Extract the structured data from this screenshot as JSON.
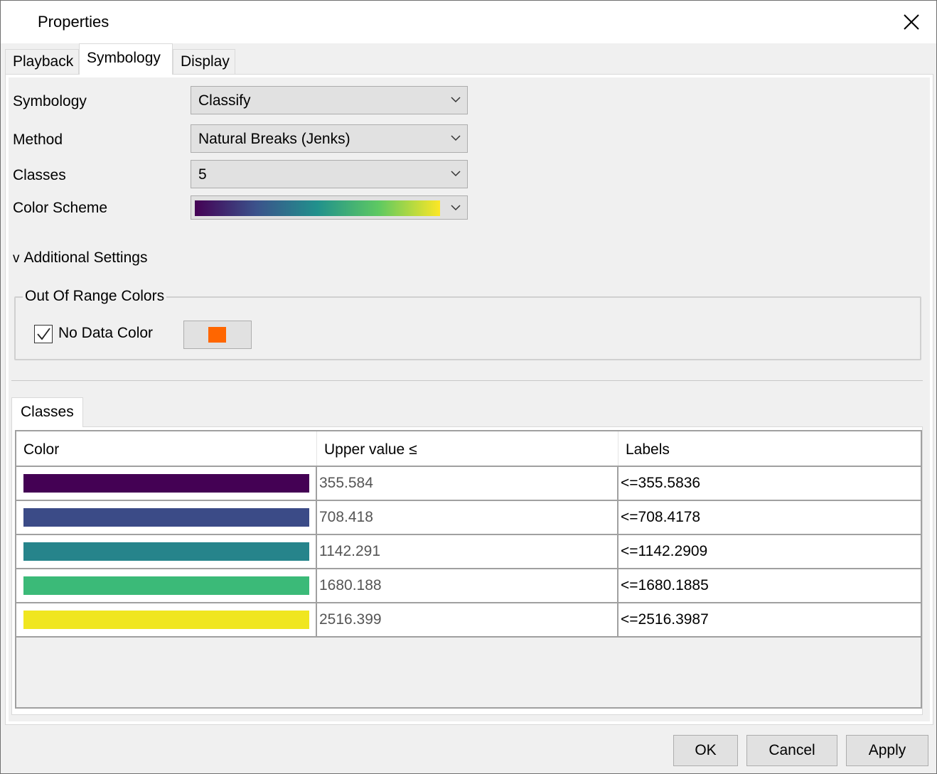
{
  "window": {
    "title": "Properties"
  },
  "tabs": [
    {
      "label": "Playback",
      "active": false
    },
    {
      "label": "Symbology",
      "active": true
    },
    {
      "label": "Display",
      "active": false
    }
  ],
  "symbology": {
    "symbology_label": "Symbology",
    "symbology_value": "Classify",
    "method_label": "Method",
    "method_value": "Natural Breaks (Jenks)",
    "classes_label": "Classes",
    "classes_value": "5",
    "color_scheme_label": "Color Scheme",
    "color_scheme_colors": [
      "#440154",
      "#3b528b",
      "#21918c",
      "#5ec962",
      "#fde725"
    ]
  },
  "additional_settings": {
    "toggle_glyph": "v",
    "label": "Additional Settings"
  },
  "out_of_range": {
    "group_title": "Out Of Range Colors",
    "no_data_label": "No Data Color",
    "no_data_checked": true,
    "no_data_color": "#ff6600"
  },
  "classes_tab": {
    "label": "Classes"
  },
  "classes_table": {
    "headers": [
      "Color",
      "Upper value ≤",
      "Labels"
    ],
    "rows": [
      {
        "color": "#440154",
        "value": "355.584",
        "label": "<=355.5836"
      },
      {
        "color": "#3b4b87",
        "value": "708.418",
        "label": "<=708.4178"
      },
      {
        "color": "#26848b",
        "value": "1142.291",
        "label": "<=1142.2909"
      },
      {
        "color": "#3bba78",
        "value": "1680.188",
        "label": "<=1680.1885"
      },
      {
        "color": "#f0e620",
        "value": "2516.399",
        "label": "<=2516.3987"
      }
    ]
  },
  "buttons": {
    "ok": "OK",
    "cancel": "Cancel",
    "apply": "Apply"
  }
}
